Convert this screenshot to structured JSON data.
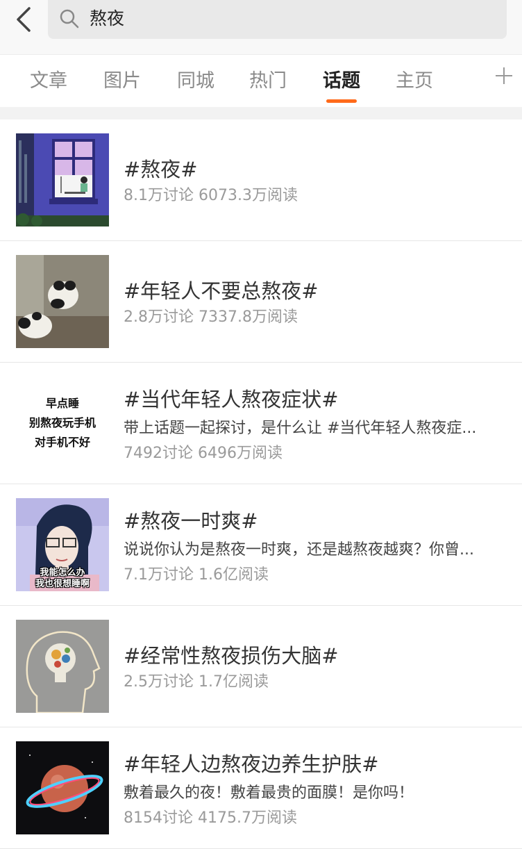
{
  "search": {
    "query": "熬夜"
  },
  "tabs": [
    {
      "label": "文章",
      "active": false
    },
    {
      "label": "图片",
      "active": false
    },
    {
      "label": "同城",
      "active": false
    },
    {
      "label": "热门",
      "active": false
    },
    {
      "label": "话题",
      "active": true
    },
    {
      "label": "主页",
      "active": false
    }
  ],
  "colors": {
    "accent": "#ff6a1a",
    "text_primary": "#333333",
    "text_secondary": "#9a9a9a"
  },
  "topics": [
    {
      "title": "#熬夜#",
      "stats": "8.1万讨论 6073.3万阅读",
      "thumb_icon": "night-window-illustration"
    },
    {
      "title": "#年轻人不要总熬夜#",
      "stats": "2.8万讨论 7337.8万阅读",
      "thumb_icon": "panda-photo"
    },
    {
      "title": "#当代年轻人熬夜症状#",
      "desc": "带上话题一起探讨，是什么让 #当代年轻人熬夜症...",
      "stats": "7492讨论 6496万阅读",
      "thumb_lines": [
        "早点睡",
        "别熬夜玩手机",
        "对手机不好"
      ]
    },
    {
      "title": "#熬夜一时爽#",
      "desc": "说说你认为是熬夜一时爽，还是越熬夜越爽？你曾...",
      "stats": "7.1万讨论 1.6亿阅读",
      "thumb_caption": [
        "我能怎么办",
        "我也很想睡啊"
      ]
    },
    {
      "title": "#经常性熬夜损伤大脑#",
      "stats": "2.5万讨论 1.7亿阅读",
      "thumb_icon": "head-lightbulb-gears-icon"
    },
    {
      "title": "#年轻人边熬夜边养生护肤#",
      "desc": "敷着最久的夜！敷着最贵的面膜！是你吗！",
      "stats": "8154讨论 4175.7万阅读",
      "thumb_icon": "planet-ring-icon"
    }
  ]
}
